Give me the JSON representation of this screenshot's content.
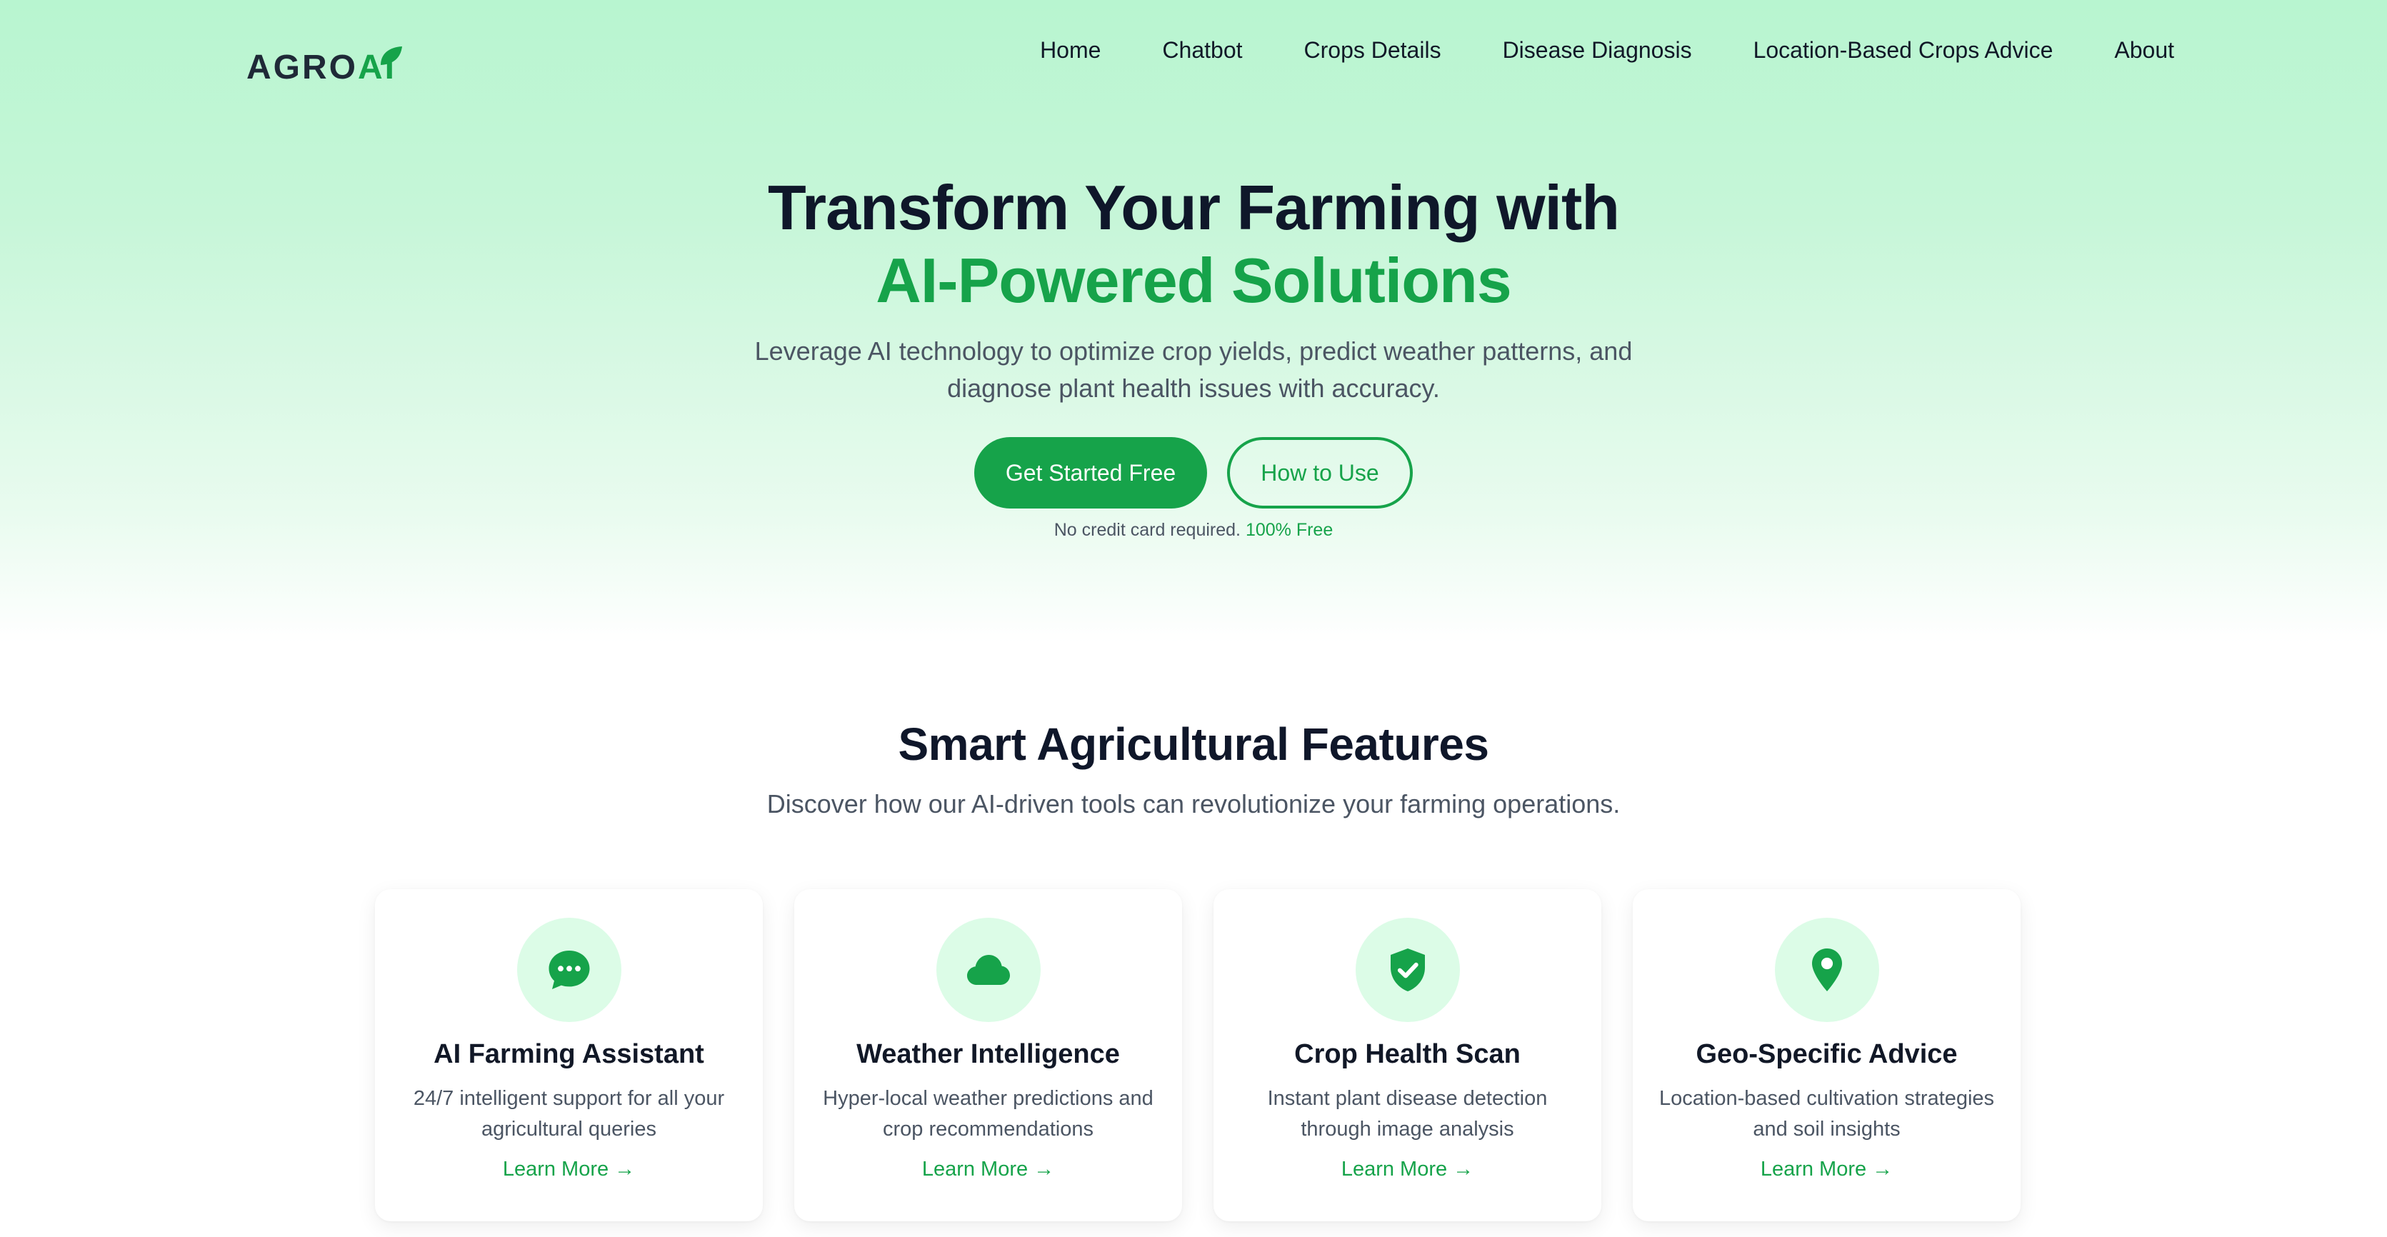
{
  "brand": {
    "logo_part1": "AGRO",
    "logo_part2": "AI",
    "accent_color": "#16a34a",
    "text_color": "#1f2937"
  },
  "nav": {
    "items": [
      {
        "label": "Home"
      },
      {
        "label": "Chatbot"
      },
      {
        "label": "Crops Details"
      },
      {
        "label": "Disease Diagnosis"
      },
      {
        "label": "Location-Based Crops Advice"
      },
      {
        "label": "About"
      }
    ]
  },
  "hero": {
    "title_line1": "Transform Your Farming with",
    "title_line2": "AI-Powered Solutions",
    "subtitle": "Leverage AI technology to optimize crop yields, predict weather patterns, and diagnose plant health issues with accuracy.",
    "primary_cta": "Get Started Free",
    "secondary_cta": "How to Use",
    "note_text": "No credit card required.",
    "note_highlight": "100% Free"
  },
  "features": {
    "title": "Smart Agricultural Features",
    "subtitle": "Discover how our AI-driven tools can revolutionize your farming operations.",
    "cards": [
      {
        "icon": "chat-bubble-icon",
        "title": "AI Farming Assistant",
        "description": "24/7 intelligent support for all your agricultural queries",
        "link": "Learn More →"
      },
      {
        "icon": "cloud-icon",
        "title": "Weather Intelligence",
        "description": "Hyper-local weather predictions and crop recommendations",
        "link": "Learn More →"
      },
      {
        "icon": "shield-check-icon",
        "title": "Crop Health Scan",
        "description": "Instant plant disease detection through image analysis",
        "link": "Learn More →"
      },
      {
        "icon": "map-pin-icon",
        "title": "Geo-Specific Advice",
        "description": "Location-based cultivation strategies and soil insights",
        "link": "Learn More →"
      }
    ]
  }
}
